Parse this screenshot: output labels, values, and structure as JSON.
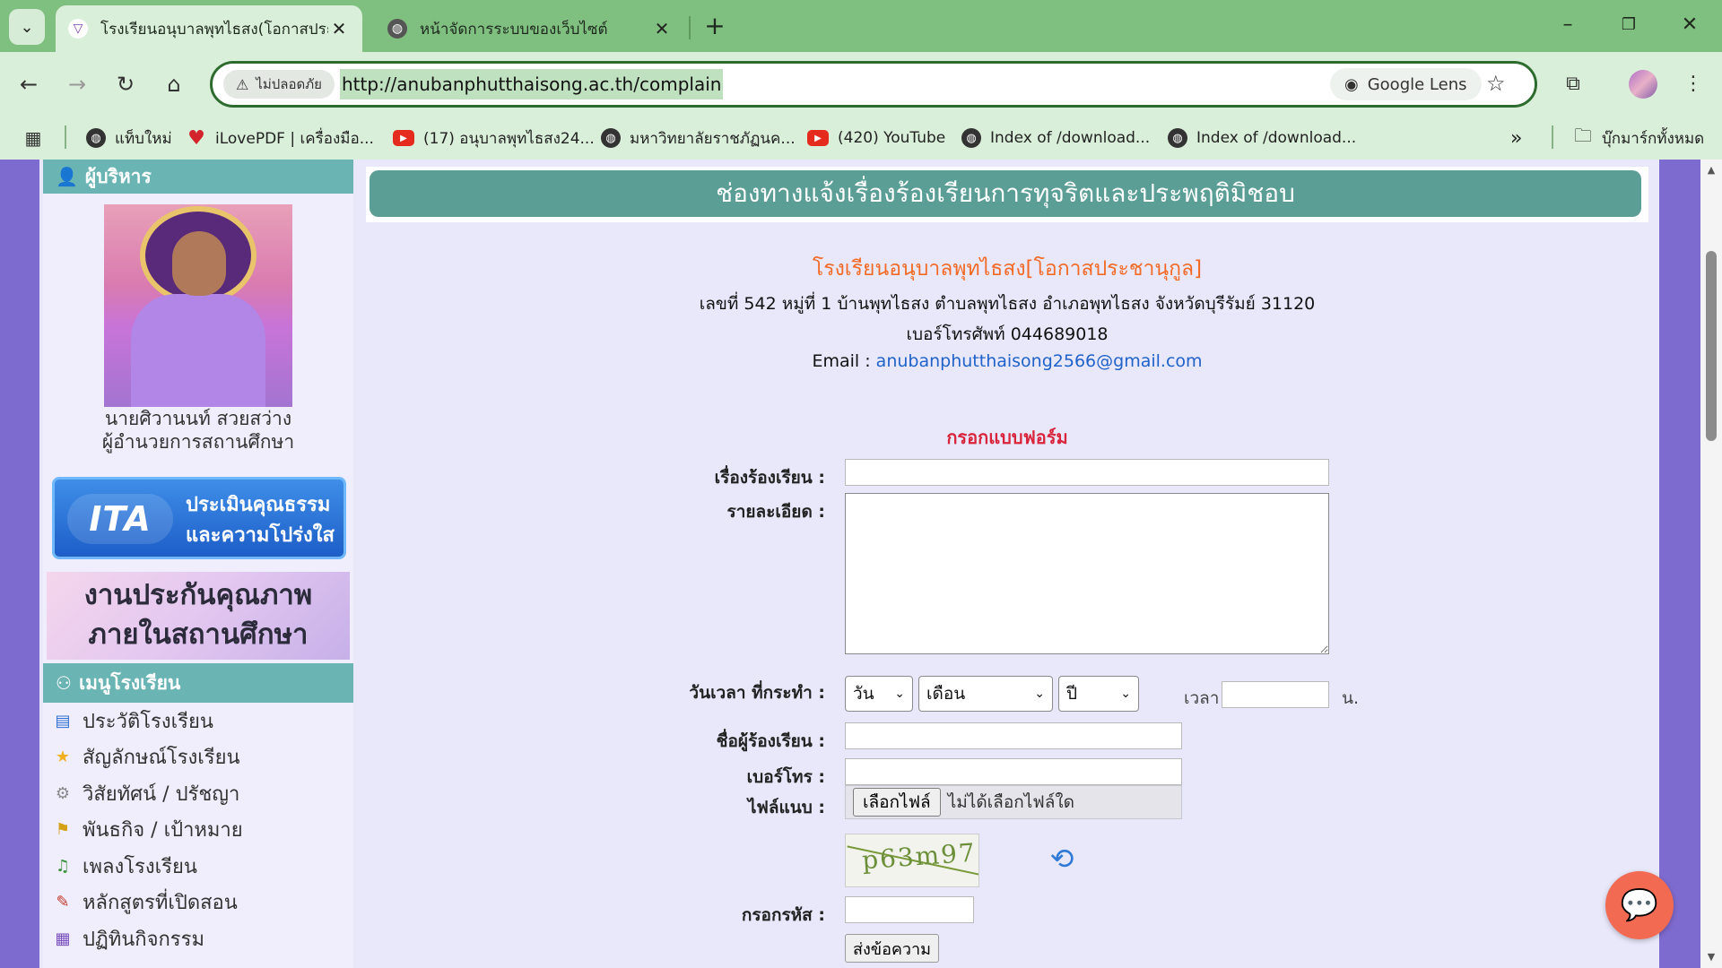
{
  "browser": {
    "tabs": [
      {
        "title": "โรงเรียนอนุบาลพุทไธสง(โอกาสประชา",
        "active": true
      },
      {
        "title": "หน้าจัดการระบบของเว็บไซต์",
        "active": false
      }
    ],
    "security_label": "ไม่ปลอดภัย",
    "url": "http://anubanphutthaisong.ac.th/complain",
    "lens_label": "Google Lens",
    "bookmarks": [
      {
        "label": "แท็บใหม่",
        "icon": "globe-icon"
      },
      {
        "label": "iLovePDF | เครื่องมือ...",
        "icon": "heart-icon"
      },
      {
        "label": "(17) อนุบาลพุทไธสง24...",
        "icon": "youtube-icon"
      },
      {
        "label": "มหาวิทยาลัยราชภัฏนค...",
        "icon": "globe-icon"
      },
      {
        "label": "(420) YouTube",
        "icon": "youtube-icon"
      },
      {
        "label": "Index of /download...",
        "icon": "globe-icon"
      },
      {
        "label": "Index of /download...",
        "icon": "globe-icon"
      }
    ],
    "all_bookmarks_label": "บุ๊กมาร์กทั้งหมด"
  },
  "sidebar": {
    "admin_heading": "ผู้บริหาร",
    "director_name": "นายศิวานนท์ สวยสว่าง",
    "director_title": "ผู้อำนวยการสถานศึกษา",
    "itas_logo_text": "ITA",
    "itas_line1": "ประเมินคุณธรรม",
    "itas_line2": "และความโปร่งใส",
    "qa_line1": "งานประกันคุณภาพ",
    "qa_line2": "ภายในสถานศึกษา",
    "menu_heading": "เมนูโรงเรียน",
    "menu_items": [
      "ประวัติโรงเรียน",
      "สัญลักษณ์โรงเรียน",
      "วิสัยทัศน์ / ปรัชญา",
      "พันธกิจ / เป้าหมาย",
      "เพลงโรงเรียน",
      "หลักสูตรที่เปิดสอน",
      "ปฏิทินกิจกรรม"
    ]
  },
  "main": {
    "banner_title": "ช่องทางแจ้งเรื่องร้องเรียนการทุจริตและประพฤติมิชอบ",
    "school_name": "โรงเรียนอนุบาลพุทไธสง[โอกาสประชานุกูล]",
    "address": "เลขที่ 542 หมู่ที่ 1 บ้านพุทไธสง   ตำบลพุทไธสง  อำเภอพุทไธสง จังหวัดบุรีรัมย์ 31120",
    "phone": "เบอร์โทรศัพท์ 044689018",
    "email_label": "Email :",
    "email": "anubanphutthaisong2566@gmail.com",
    "form_title": "กรอกแบบฟอร์ม",
    "form": {
      "subject_label": "เรื่องร้องเรียน :",
      "subject_value": "",
      "detail_label": "รายละเอียด :",
      "detail_value": "",
      "datetime_label": "วันเวลา ที่กระทำ :",
      "day_selected": "วัน",
      "month_selected": "เดือน",
      "year_selected": "ปี",
      "time_label": "เวลา",
      "time_value": "",
      "time_unit": "น.",
      "name_label": "ชื่อผู้ร้องเรียน :",
      "name_value": "",
      "phone_label": "เบอร์โทร :",
      "phone_value": "",
      "attach_label": "ไฟล์แนบ :",
      "choose_file": "เลือกไฟล์",
      "no_file": "ไม่ได้เลือกไฟล์ใด",
      "captcha_text": "p63m97",
      "code_label": "กรอกรหัส :",
      "code_value": "",
      "submit_label": "ส่งข้อความ"
    }
  }
}
